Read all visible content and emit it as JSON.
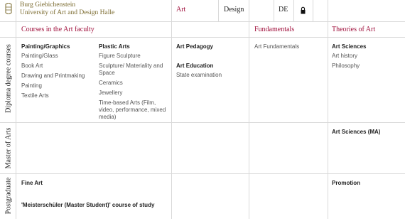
{
  "header": {
    "logo_line1": "Burg Giebichenstein",
    "logo_line2": "University of Art and Design Halle",
    "nav": {
      "art": "Art",
      "design": "Design",
      "lang": "DE"
    },
    "lock_icon": "lock-icon"
  },
  "columns": {
    "art_faculty": "Courses in the Art faculty",
    "fundamentals": "Fundamentals",
    "theories": "Theories of Art"
  },
  "rows": {
    "diploma": "Diploma degree courses",
    "master": "Master of Arts",
    "postgrad": "Postgraduate"
  },
  "diploma": {
    "painting_graphics": {
      "title": "Painting/Graphics",
      "items": [
        "Painting/Glass",
        "Book Art",
        "Drawing and Printmaking",
        "Painting",
        "Textile Arts"
      ]
    },
    "plastic_arts": {
      "title": "Plastic Arts",
      "items": [
        "Figure Sculpture",
        "Sculpture/ Materiality and Space",
        "Ceramics",
        "Jewellery",
        "Time-based Arts (Film, video, performance, mixed media)"
      ]
    },
    "art_pedagogy": {
      "title": "Art Pedagogy"
    },
    "art_education": {
      "title": "Art Education",
      "items": [
        "State examination"
      ]
    },
    "fundamentals": {
      "items": [
        "Art Fundamentals"
      ]
    },
    "art_sciences": {
      "title": "Art Sciences",
      "items": [
        "Art history",
        "Philosophy"
      ]
    }
  },
  "master": {
    "art_sciences_ma": "Art Sciences (MA)"
  },
  "postgrad": {
    "fine_art": "Fine Art",
    "meisterschueler": "'Meisterschüler (Master Student)' course of study",
    "promotion": "Promotion"
  },
  "colors": {
    "accent": "#a0103c",
    "logo": "#7a6a2e",
    "rule": "#d9d9d9"
  }
}
